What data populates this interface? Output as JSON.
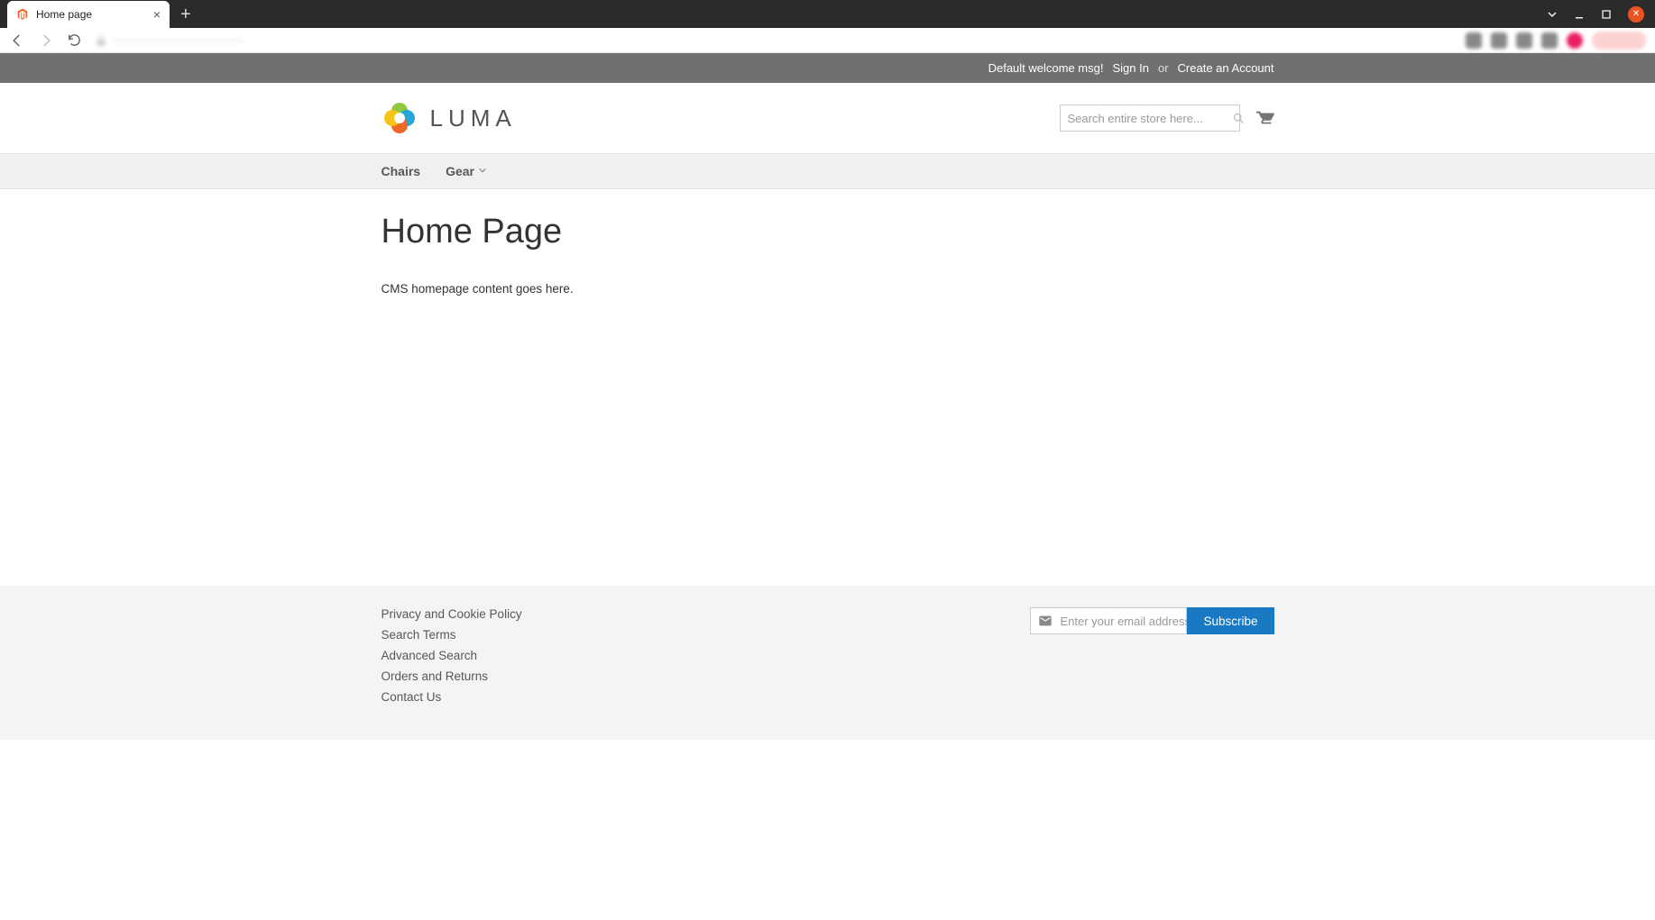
{
  "browser": {
    "tab_title": "Home page",
    "url_blur": "———————————"
  },
  "panel": {
    "welcome": "Default welcome msg!",
    "sign_in": "Sign In",
    "or": "or",
    "create_account": "Create an Account"
  },
  "header": {
    "logo_text": "LUMA",
    "search_placeholder": "Search entire store here..."
  },
  "nav": {
    "items": [
      {
        "label": "Chairs",
        "has_submenu": false
      },
      {
        "label": "Gear",
        "has_submenu": true
      }
    ]
  },
  "main": {
    "title": "Home Page",
    "content": "CMS homepage content goes here."
  },
  "footer": {
    "links": [
      "Privacy and Cookie Policy",
      "Search Terms",
      "Advanced Search",
      "Orders and Returns",
      "Contact Us"
    ],
    "newsletter_placeholder": "Enter your email address",
    "subscribe_label": "Subscribe"
  }
}
